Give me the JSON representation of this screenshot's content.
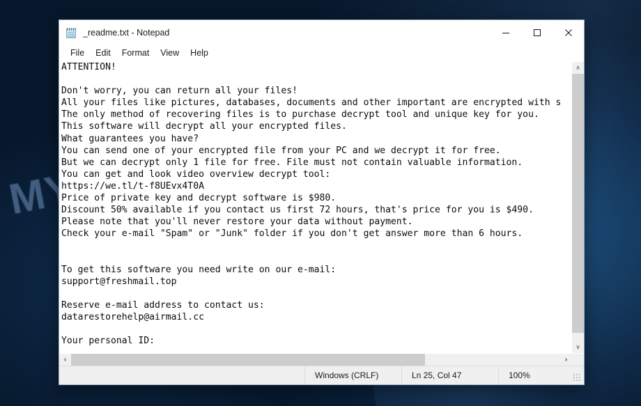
{
  "window": {
    "title": "_readme.txt - Notepad",
    "icon": "notepad-icon",
    "caption": {
      "minimize": "—",
      "maximize": "☐",
      "close": "✕"
    }
  },
  "menu": {
    "items": [
      "File",
      "Edit",
      "Format",
      "View",
      "Help"
    ]
  },
  "document": {
    "text": "ATTENTION!\n\nDon't worry, you can return all your files!\nAll your files like pictures, databases, documents and other important are encrypted with s\nThe only method of recovering files is to purchase decrypt tool and unique key for you.\nThis software will decrypt all your encrypted files.\nWhat guarantees you have?\nYou can send one of your encrypted file from your PC and we decrypt it for free.\nBut we can decrypt only 1 file for free. File must not contain valuable information.\nYou can get and look video overview decrypt tool:\nhttps://we.tl/t-f8UEvx4T0A\nPrice of private key and decrypt software is $980.\nDiscount 50% available if you contact us first 72 hours, that's price for you is $490.\nPlease note that you'll never restore your data without payment.\nCheck your e-mail \"Spam\" or \"Junk\" folder if you don't get answer more than 6 hours.\n\n\nTo get this software you need write on our e-mail:\nsupport@freshmail.top\n\nReserve e-mail address to contact us:\ndatarestorehelp@airmail.cc\n\nYour personal ID:"
  },
  "scrollbars": {
    "vertical": {
      "up_arrow": "∧",
      "down_arrow": "∨"
    },
    "horizontal": {
      "left_arrow": "‹",
      "right_arrow": "›"
    }
  },
  "statusbar": {
    "line_ending": "Windows (CRLF)",
    "cursor_position": "Ln 25, Col 47",
    "zoom": "100%"
  },
  "desktop": {
    "watermark": "MYANTISPYWARE.COM"
  },
  "colors": {
    "window_bg": "#ffffff",
    "scrollbar_track": "#f0f0f0",
    "scrollbar_thumb": "#cdcdcd",
    "statusbar_bg": "#f0f0f0",
    "text": "#0b0b0b",
    "desktop": "#0d2744",
    "watermark": "#96bef0"
  }
}
